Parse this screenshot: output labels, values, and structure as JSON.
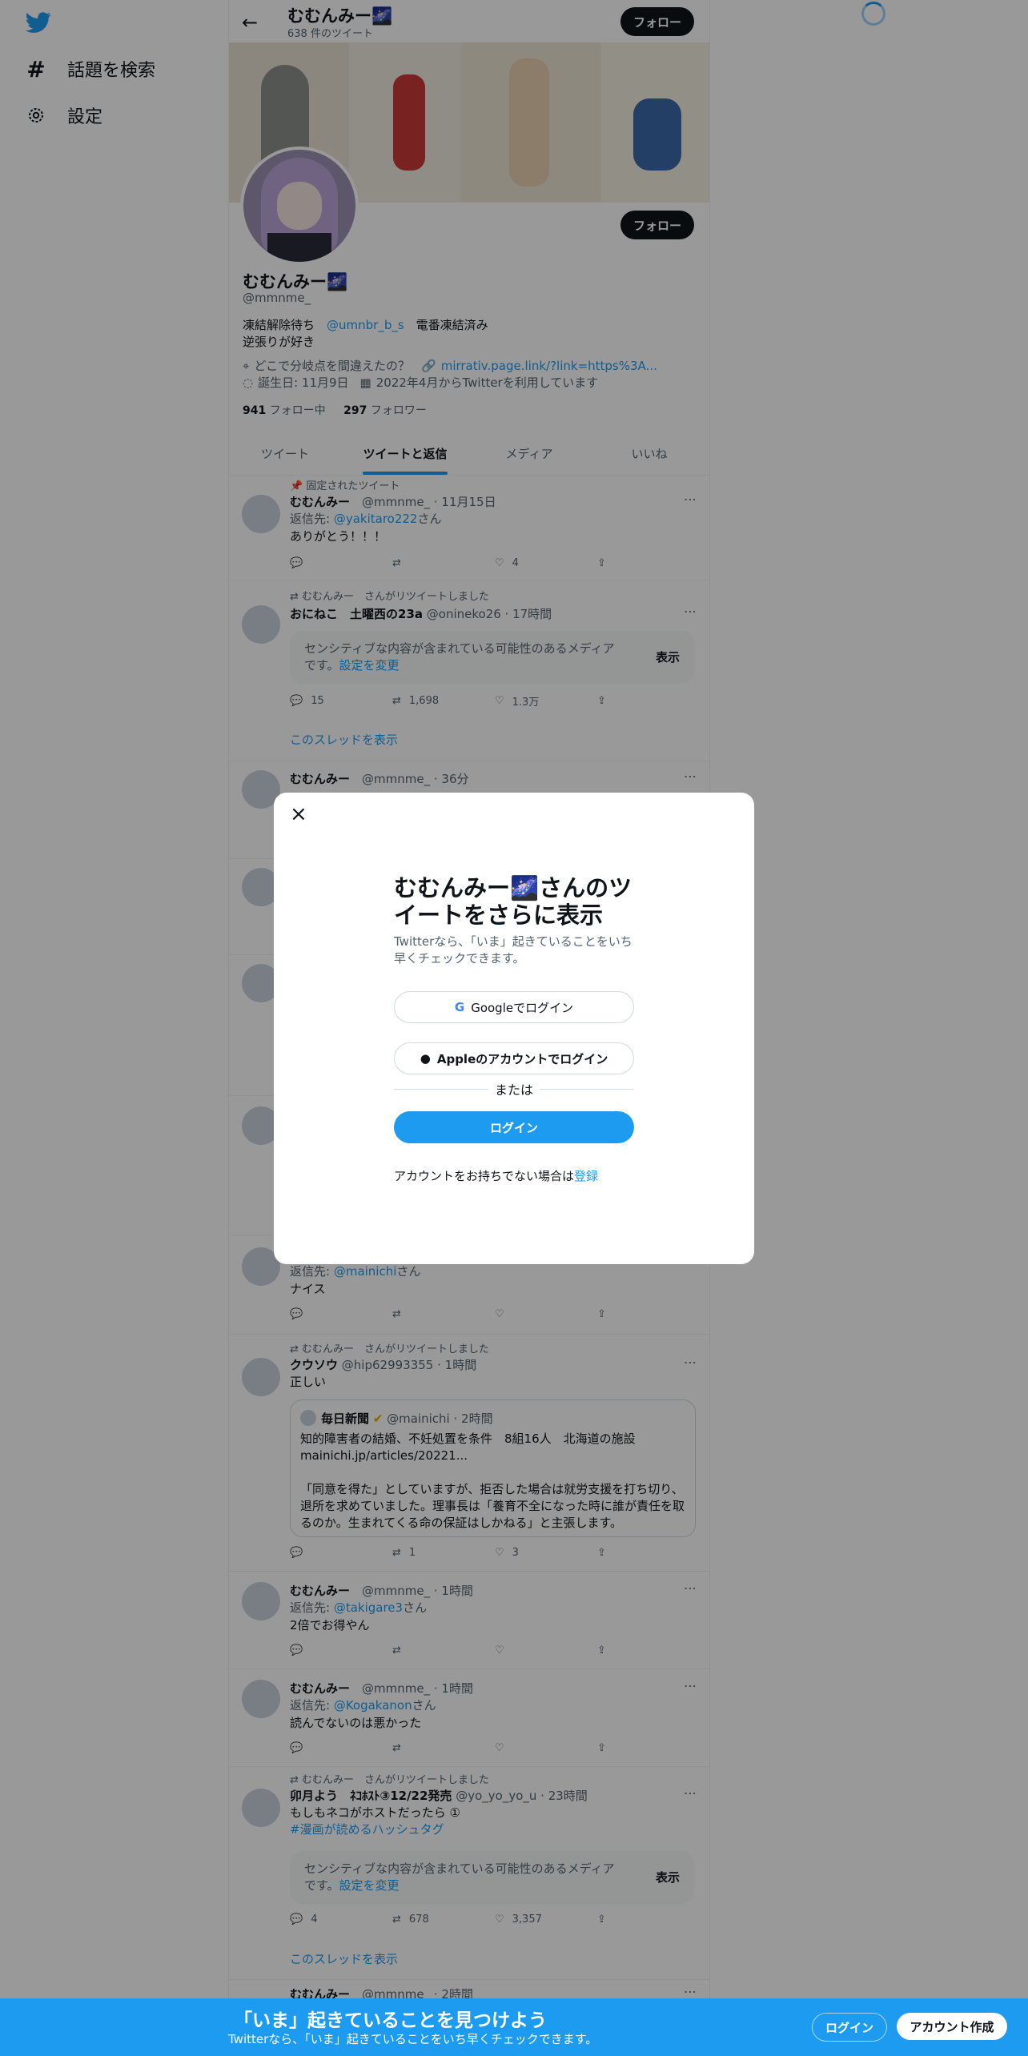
{
  "nav": {
    "explore": "話題を検索",
    "settings": "設定"
  },
  "header": {
    "name": "むむんみー🌌",
    "tweet_count": "638 件のツイート",
    "follow": "フォロー"
  },
  "profile": {
    "name": "むむんみー🌌",
    "handle": "@mmnme_",
    "bio_pre": "凍結解除待ち　",
    "bio_link": "@umnbr_b_s",
    "bio_post": "　電番凍結済み",
    "bio_line2": "逆張りが好き",
    "location": "どこで分岐点を間違えたの？",
    "url": "mirrativ.page.link/?link=https%3A...",
    "birthday": "誕生日: 11月9日",
    "joined": "2022年4月からTwitterを利用しています",
    "following_count": "941",
    "following_label": "フォロー中",
    "followers_count": "297",
    "followers_label": "フォロワー",
    "follow": "フォロー"
  },
  "tabs": [
    "ツイート",
    "ツイートと返信",
    "メディア",
    "いいね"
  ],
  "tweets": {
    "t1": {
      "pinned": "固定されたツイート",
      "name": "むむんみー",
      "meta": "@mmnme_ · 11月15日",
      "reply_pre": "返信先: ",
      "reply_to": "@yakitaro222",
      "reply_post": "さん",
      "text": "ありがとう！！！",
      "like": "4"
    },
    "t2": {
      "rt": "むむんみー　さんがリツイートしました",
      "name": "おにねこ　土曜西の23a",
      "meta": "@onineko26 · 17時間",
      "sensitive": "センシティブな内容が含まれている可能性のあるメディアです。",
      "change": "設定を変更",
      "show": "表示",
      "reply": "15",
      "retweet": "1,698",
      "like": "1.3万",
      "thread": "このスレッドを表示"
    },
    "t3": {
      "name": "むむんみー",
      "meta": "@mmnme_ · 36分"
    },
    "t4": {
      "reply_pre": "返信先: ",
      "reply_to": "@mainichi",
      "reply_post": "さん",
      "text": "ナイス"
    },
    "t5": {
      "rt": "むむんみー　さんがリツイートしました",
      "name": "クウソウ",
      "meta": "@hip62993355 · 1時間",
      "text": "正しい",
      "q_name": "毎日新聞",
      "q_meta": "@mainichi · 2時間",
      "q_line1": "知的障害者の結婚、不妊処置を条件　8組16人　北海道の施設",
      "q_line2": "mainichi.jp/articles/20221...",
      "q_body": "「同意を得た」としていますが、拒否した場合は就労支援を打ち切り、退所を求めていました。理事長は「養育不全になった時に誰が責任を取るのか。生まれてくる命の保証はしかねる」と主張します。",
      "retweet": "1",
      "like": "3"
    },
    "t6": {
      "name": "むむんみー",
      "meta": "@mmnme_ · 1時間",
      "reply_pre": "返信先: ",
      "reply_to": "@takigare3",
      "reply_post": "さん",
      "text": "2倍でお得やん"
    },
    "t7": {
      "name": "むむんみー",
      "meta": "@mmnme_ · 1時間",
      "reply_pre": "返信先: ",
      "reply_to": "@Kogakanon",
      "reply_post": "さん",
      "text": "読んでないのは悪かった"
    },
    "t8": {
      "rt": "むむんみー　さんがリツイートしました",
      "name": "卯月よう　ﾈｺﾎｽﾄ③12/22発売",
      "meta": "@yo_yo_yo_u · 23時間",
      "text": "もしもネコがホストだったら ①",
      "hashtag": "#漫画が読めるハッシュタグ",
      "sensitive": "センシティブな内容が含まれている可能性のあるメディアです。",
      "change": "設定を変更",
      "show": "表示",
      "reply": "4",
      "retweet": "678",
      "like": "3,357",
      "thread": "このスレッドを表示"
    },
    "t9": {
      "name": "むむんみー",
      "meta": "@mmnme_ · 2時間"
    }
  },
  "modal": {
    "title": "むむんみー🌌さんのツイートをさらに表示",
    "subtitle": "Twitterなら、「いま」起きていることをいち早くチェックできます。",
    "google": "Googleでログイン",
    "apple": "Appleのアカウントでログイン",
    "or": "または",
    "login": "ログイン",
    "signup_pre": "アカウントをお持ちでない場合は",
    "signup_link": "登録"
  },
  "bottom": {
    "title": "「いま」起きていることを見つけよう",
    "subtitle": "Twitterなら、「いま」起きていることをいち早くチェックできます。",
    "login": "ログイン",
    "signup": "アカウント作成"
  },
  "colors": {
    "accent": "#1d9bf0",
    "dark": "#0f1419",
    "muted": "#536471"
  }
}
